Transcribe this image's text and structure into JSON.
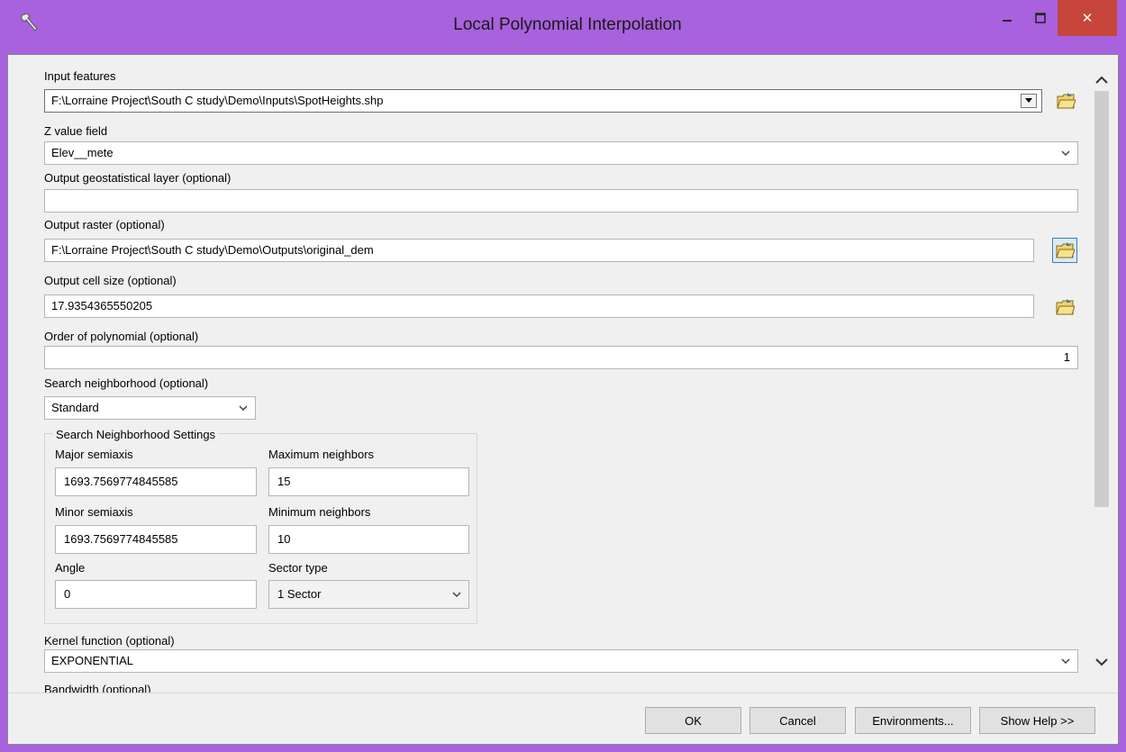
{
  "window": {
    "title": "Local Polynomial Interpolation",
    "close_symbol": "✕",
    "frame_color": "#a862dd"
  },
  "form": {
    "input_features": {
      "label": "Input features",
      "value": "F:\\Lorraine Project\\South C study\\Demo\\Inputs\\SpotHeights.shp"
    },
    "z_value_field": {
      "label": "Z value field",
      "value": "Elev__mete"
    },
    "output_geostatistical_layer": {
      "label": "Output geostatistical layer (optional)",
      "value": ""
    },
    "output_raster": {
      "label": "Output raster (optional)",
      "value": "F:\\Lorraine Project\\South C study\\Demo\\Outputs\\original_dem"
    },
    "output_cell_size": {
      "label": "Output cell size (optional)",
      "value": "17.9354365550205"
    },
    "order_of_polynomial": {
      "label": "Order of polynomial (optional)",
      "value": "1"
    },
    "search_neighborhood": {
      "label": "Search neighborhood (optional)",
      "value": "Standard"
    },
    "kernel_function": {
      "label": "Kernel function (optional)",
      "value": "EXPONENTIAL"
    },
    "bandwidth": {
      "label": "Bandwidth (optional)"
    }
  },
  "neighborhood_settings": {
    "title": "Search Neighborhood Settings",
    "major_semiaxis": {
      "label": "Major semiaxis",
      "value": "1693.7569774845585"
    },
    "maximum_neighbors": {
      "label": "Maximum neighbors",
      "value": "15"
    },
    "minor_semiaxis": {
      "label": "Minor semiaxis",
      "value": "1693.7569774845585"
    },
    "minimum_neighbors": {
      "label": "Minimum neighbors",
      "value": "10"
    },
    "angle": {
      "label": "Angle",
      "value": "0"
    },
    "sector_type": {
      "label": "Sector type",
      "value": "1 Sector"
    }
  },
  "buttons": {
    "ok": "OK",
    "cancel": "Cancel",
    "environments": "Environments...",
    "show_help": "Show Help >>"
  },
  "icons": {
    "app": "hammer-icon",
    "browse": "folder-open-icon",
    "dropdown": "chevron-down-icon",
    "scroll_up": "chevron-up-icon",
    "scroll_down": "chevron-down-icon"
  }
}
